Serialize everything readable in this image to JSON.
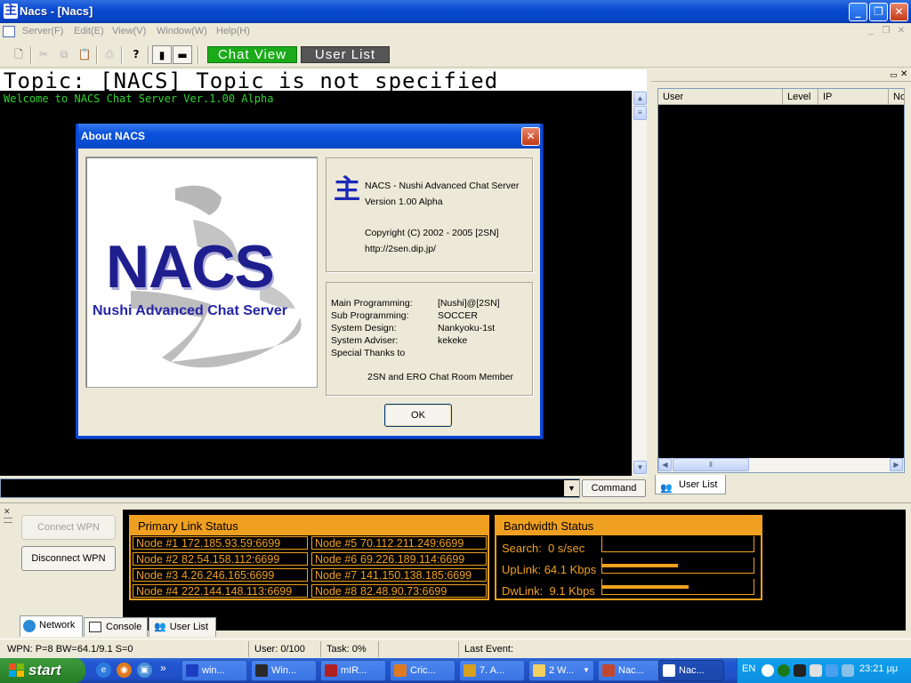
{
  "window": {
    "title": "Nacs - [Nacs]",
    "app_icon": "主"
  },
  "menu": {
    "items": [
      "Server(F)",
      "Edit(E)",
      "View(V)",
      "Window(W)",
      "Help(H)"
    ]
  },
  "toolbar": {
    "chat_view_label": "Chat View",
    "user_list_label": "User List"
  },
  "chat": {
    "topic": "Topic: [NACS] Topic is not specified",
    "welcome": "Welcome to NACS Chat Server Ver.1.00 Alpha",
    "command_label": "Command"
  },
  "users": {
    "columns": [
      "User",
      "Level",
      "IP",
      "No"
    ],
    "tab_label": "User List"
  },
  "about": {
    "title": "About NACS",
    "logo_text": "NACS",
    "logo_subtitle": "Nushi Advanced Chat Server",
    "product": "NACS - Nushi Advanced Chat Server",
    "version": "Version 1.00 Alpha",
    "copyright": "Copyright (C) 2002 - 2005  [2SN]",
    "url": "http://2sen.dip.jp/",
    "credits": [
      {
        "role": "Main Programming:",
        "name": "[Nushi]@[2SN]"
      },
      {
        "role": "Sub Programming:",
        "name": "SOCCER"
      },
      {
        "role": "System Design:",
        "name": "Nankyoku-1st"
      },
      {
        "role": "System Adviser:",
        "name": "kekeke"
      },
      {
        "role": "Special Thanks to",
        "name": ""
      }
    ],
    "thanks": "2SN and ERO Chat Room Member",
    "ok_label": "OK"
  },
  "network": {
    "connect_label": "Connect WPN",
    "disconnect_label": "Disconnect WPN",
    "primary_title": "Primary Link Status",
    "nodes": [
      {
        "label": "Node #1",
        "addr": "172.185.93.59:6699"
      },
      {
        "label": "Node #2",
        "addr": "82.54.158.112:6699"
      },
      {
        "label": "Node #3",
        "addr": "4.26.246.165:6699"
      },
      {
        "label": "Node #4",
        "addr": "222.144.148.113:6699"
      },
      {
        "label": "Node #5",
        "addr": "70.112.211.249:6699"
      },
      {
        "label": "Node #6",
        "addr": "69.226.189.114:6699"
      },
      {
        "label": "Node #7",
        "addr": "141.150.138.185:6699"
      },
      {
        "label": "Node #8",
        "addr": "82.48.90.73:6699"
      }
    ],
    "bandwidth_title": "Bandwidth Status",
    "bandwidth": [
      {
        "label": "Search:",
        "value": "0 s/sec",
        "fill": 0.0
      },
      {
        "label": "UpLink:",
        "value": "64.1 Kbps",
        "fill": 0.5
      },
      {
        "label": "DwLink:",
        "value": "9.1 Kbps",
        "fill": 0.57
      }
    ],
    "tabs": [
      "Network",
      "Console",
      "User List"
    ]
  },
  "statusbar": {
    "wpn": "WPN:  P=8 BW=64.1/9.1 S=0",
    "user": "User:  0/100",
    "task": "Task:  0%",
    "last_event": "Last Event:"
  },
  "taskbar": {
    "start_label": "start",
    "tasks": [
      "win...",
      "Win...",
      "mIR...",
      "Cric...",
      "7. A...",
      "2 W...",
      "Nac...",
      "Nac..."
    ],
    "lang": "EN",
    "clock": "23:21 μμ"
  },
  "colors": {
    "chat_green": "#2fd32f",
    "net_orange": "#f0a020",
    "xp_blue": "#0a4bd2"
  }
}
